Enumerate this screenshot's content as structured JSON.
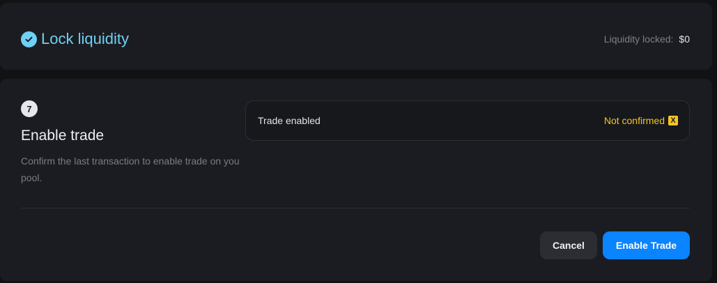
{
  "lock_section": {
    "title": "Lock liquidity",
    "liquidity_label": "Liquidity locked:",
    "liquidity_value": "$0"
  },
  "trade_step": {
    "step_number": "7",
    "title": "Enable trade",
    "description": "Confirm the last transaction to enable trade on you pool.",
    "status_label": "Trade enabled",
    "status_value": "Not confirmed",
    "status_icon": "x-icon",
    "status_icon_text": "X"
  },
  "actions": {
    "cancel_label": "Cancel",
    "enable_label": "Enable Trade"
  },
  "colors": {
    "accent_blue": "#0a84ff",
    "check_cyan": "#6fd0f5",
    "warning_yellow": "#f3c623"
  }
}
